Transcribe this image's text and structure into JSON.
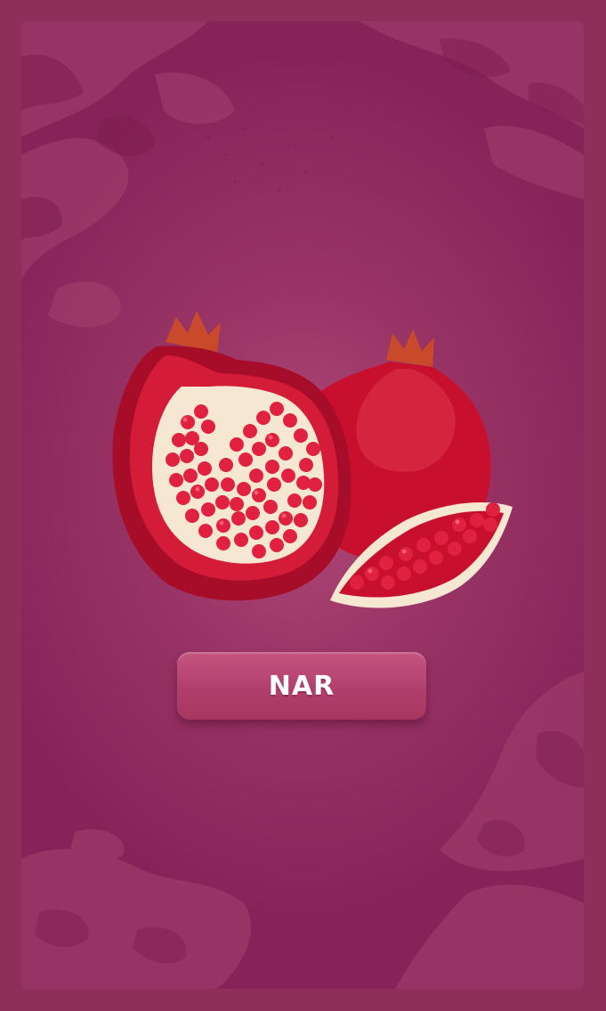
{
  "card": {
    "fruit_icon": "pomegranate-illustration",
    "answer_label": "NAR"
  },
  "colors": {
    "frame": "#8e2f5b",
    "card_center": "#b04a7a",
    "card_edge": "#86245a",
    "button": "#b13f6c",
    "fruit_red": "#c8102e",
    "fruit_dark": "#9b0c26",
    "pith": "#f6e7d2",
    "aril": "#e0213f"
  }
}
